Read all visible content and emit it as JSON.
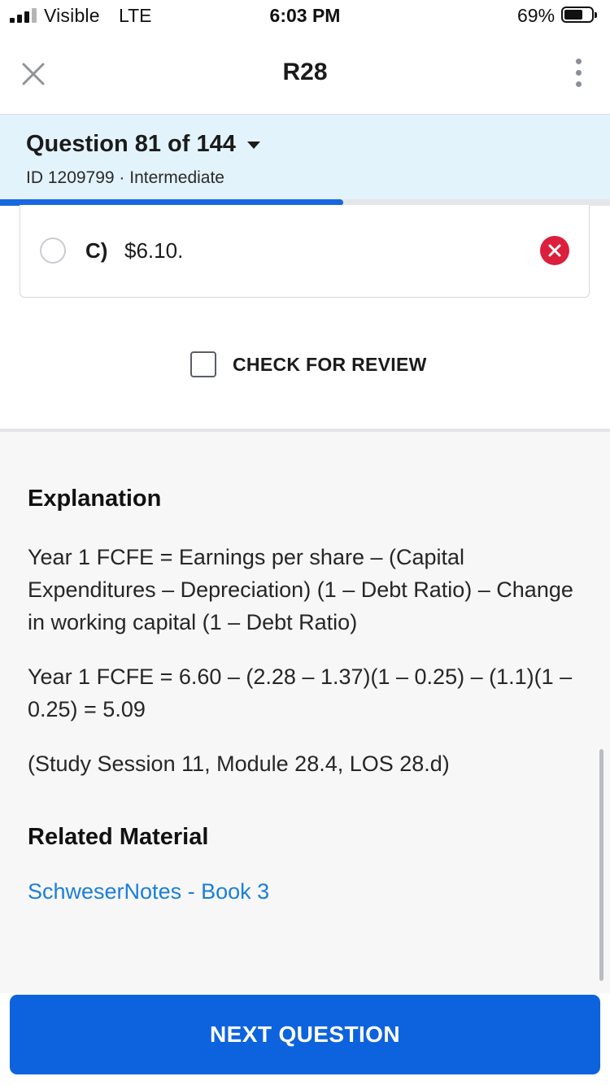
{
  "status_bar": {
    "carrier": "Visible",
    "network": "LTE",
    "time": "6:03 PM",
    "battery_percent": "69%",
    "battery_level": 0.69,
    "signal_bars_filled": 3,
    "signal_bars_total": 4
  },
  "header": {
    "title": "R28",
    "close_icon": "close-icon",
    "more_icon": "more-vertical-icon"
  },
  "question": {
    "number_label": "Question 81 of 144",
    "meta": "ID 1209799 · Intermediate",
    "progress_fraction": 0.5625
  },
  "answer": {
    "letter": "C)",
    "text": "$6.10.",
    "status_icon": "incorrect-icon",
    "status_color": "#db1f3c"
  },
  "review": {
    "label": "CHECK FOR REVIEW",
    "checked": false
  },
  "explanation": {
    "heading": "Explanation",
    "paragraphs": [
      "Year 1 FCFE = Earnings per share – (Capital Expenditures – Depreciation) (1 – Debt Ratio) – Change in working capital (1 – Debt Ratio)",
      "Year 1 FCFE = 6.60 – (2.28 – 1.37)(1 – 0.25) – (1.1)(1 – 0.25) = 5.09",
      "(Study Session 11, Module 28.4, LOS 28.d)"
    ]
  },
  "related": {
    "heading": "Related Material",
    "link": "SchweserNotes - Book 3",
    "link_color": "#1a7fd8"
  },
  "footer": {
    "next_label": "NEXT QUESTION",
    "accent_color": "#0d63dd"
  }
}
